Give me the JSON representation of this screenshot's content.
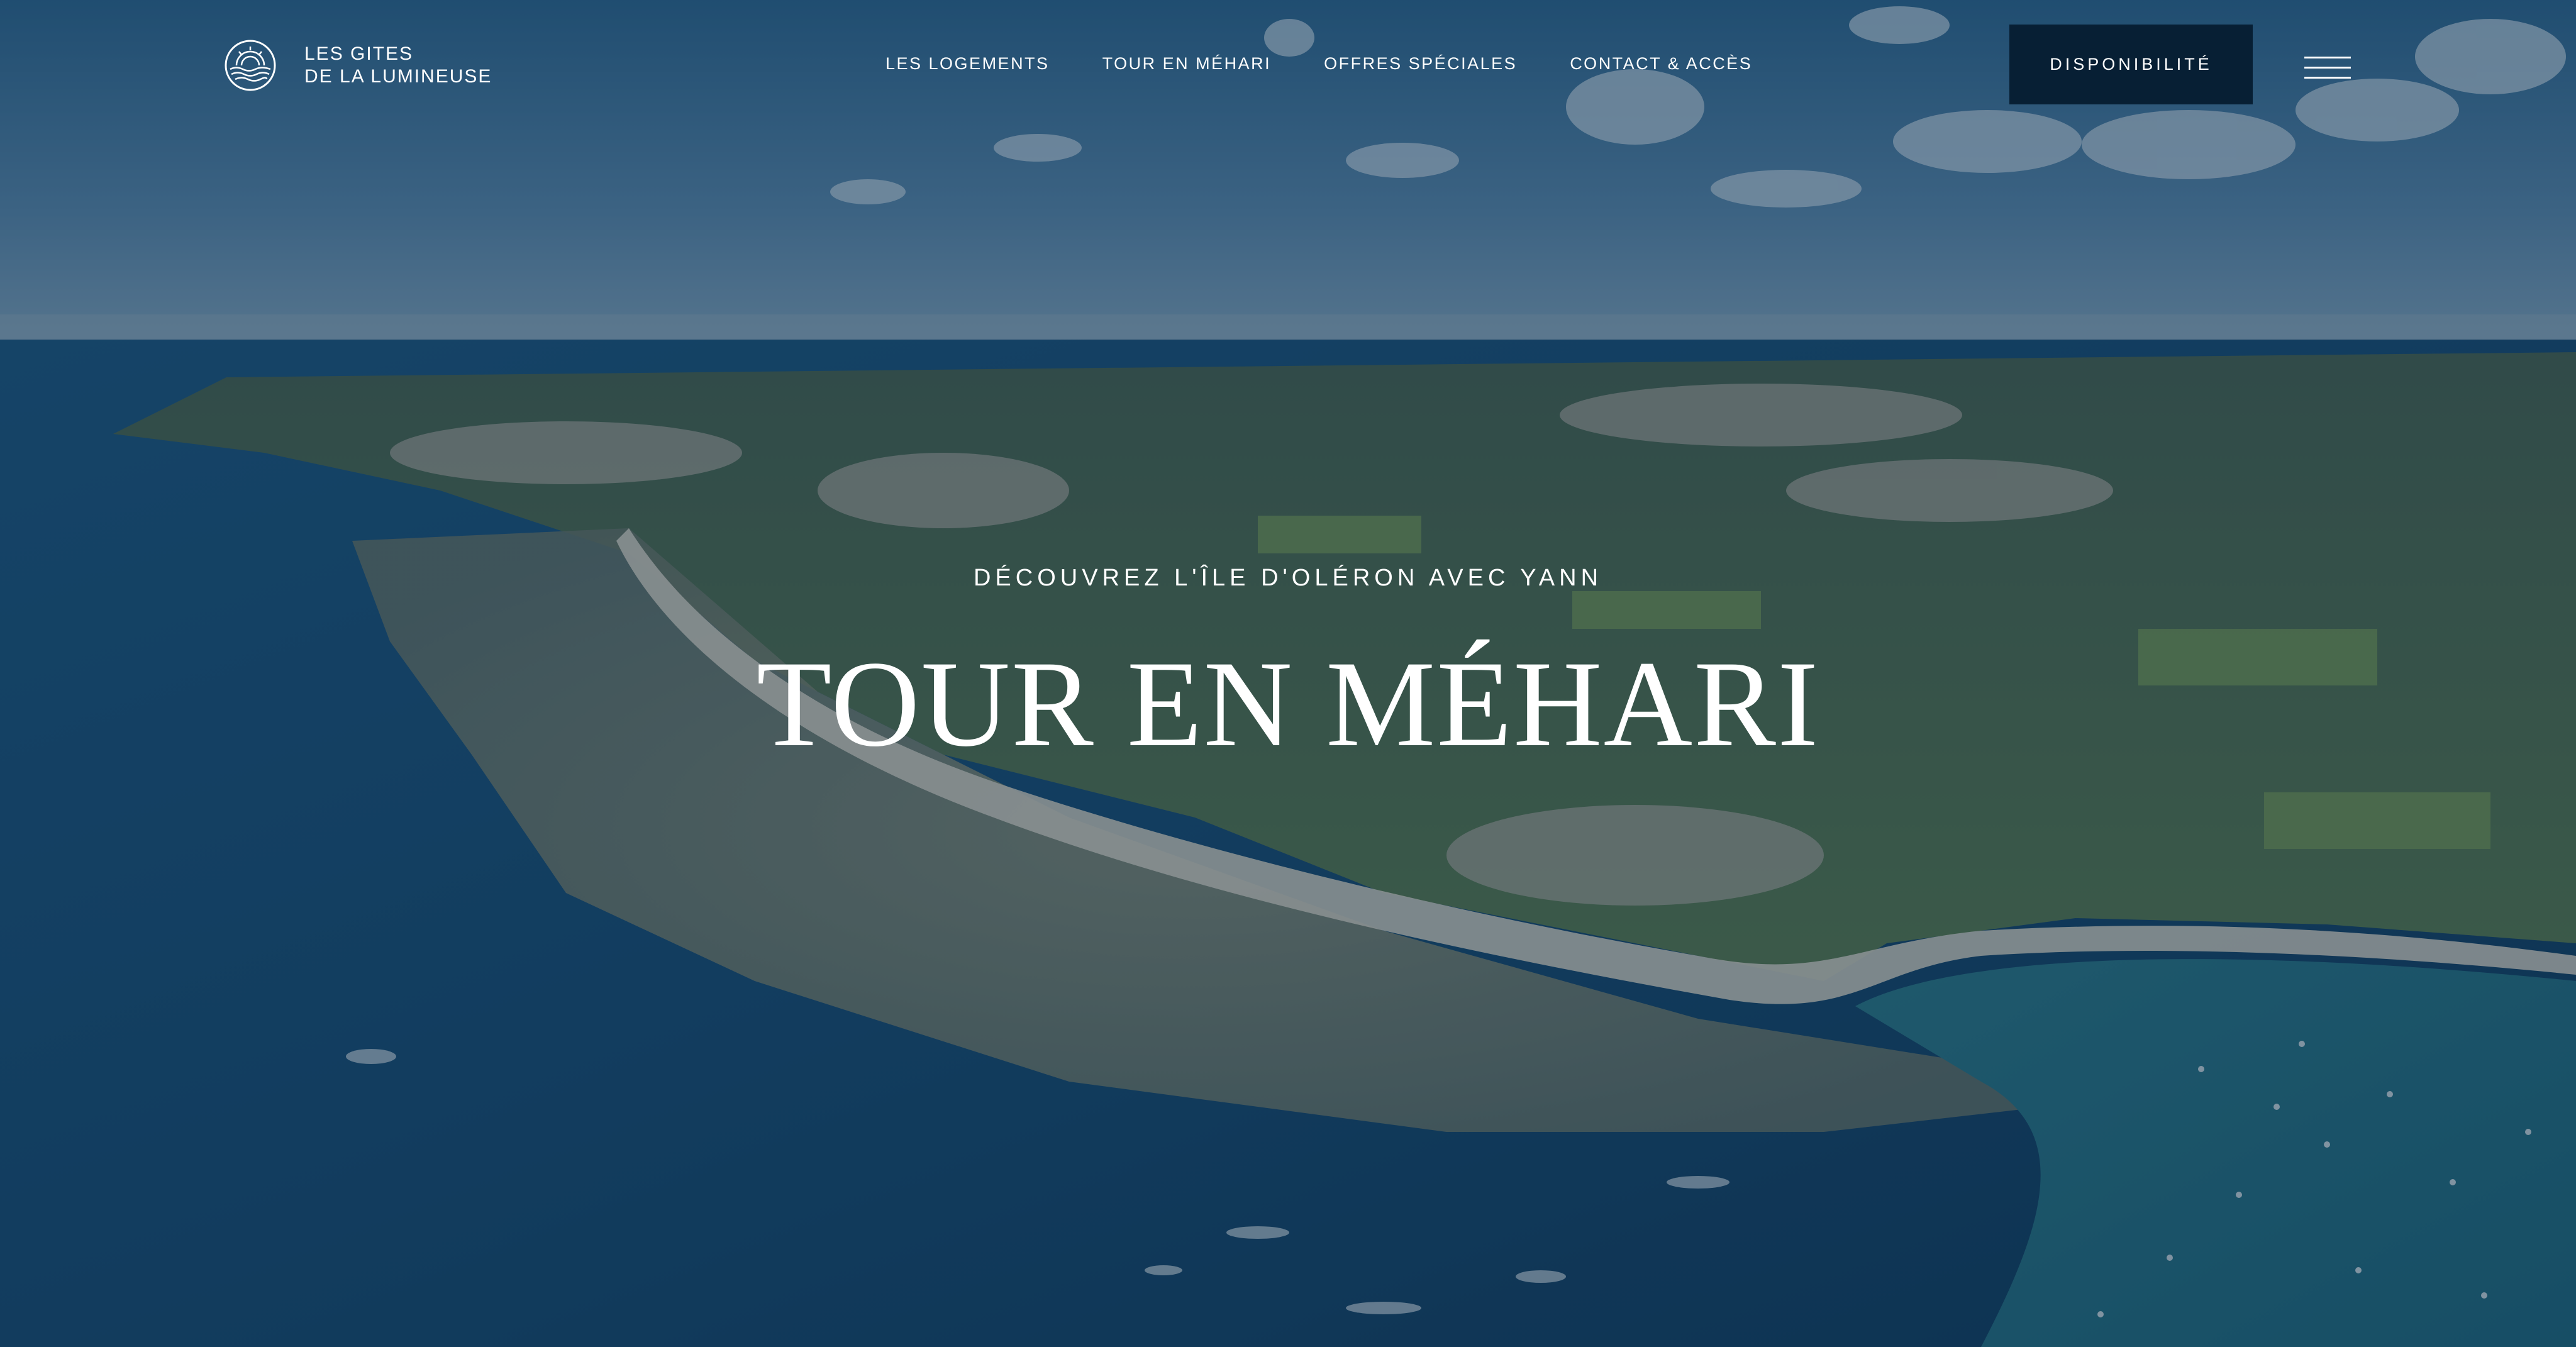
{
  "site": {
    "logo_line1": "LES GITES",
    "logo_line2": "DE LA LUMINEUSE",
    "logo_icon": "sun-over-waves-icon"
  },
  "nav": {
    "items": [
      {
        "label": "LES LOGEMENTS"
      },
      {
        "label": "TOUR EN MÉHARI"
      },
      {
        "label": "OFFRES SPÉCIALES"
      },
      {
        "label": "CONTACT & ACCÈS"
      }
    ]
  },
  "header": {
    "cta_label": "DISPONIBILITÉ",
    "menu_icon": "hamburger-menu-icon"
  },
  "hero": {
    "eyebrow": "DÉCOUVREZ L'ÎLE D'OLÉRON AVEC YANN",
    "title": "TOUR EN MÉHARI",
    "background": "aerial-coastline-photo"
  },
  "colors": {
    "cta_background": "#071f34",
    "overlay": "#0c2640",
    "text": "#ffffff"
  }
}
